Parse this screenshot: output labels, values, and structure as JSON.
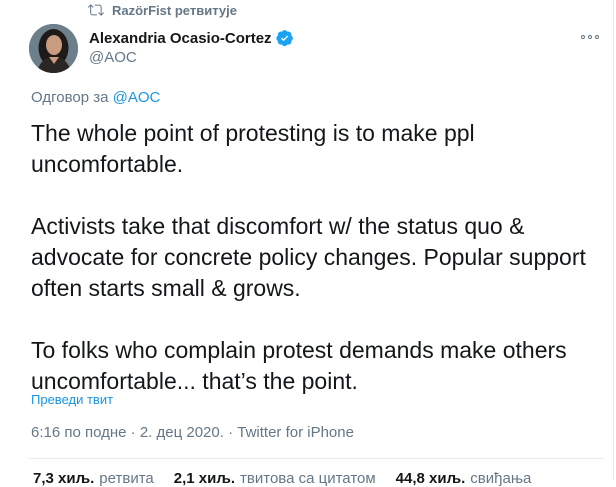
{
  "retweet_header": {
    "icon": "retweet-icon",
    "text": "RazörFist ретвитује"
  },
  "author": {
    "name": "Alexandria Ocasio-Cortez",
    "handle": "@AOC",
    "verified_icon": "verified-badge-icon",
    "verified_color": "#1da1f2"
  },
  "more_icon": "more-options-icon",
  "reply_to": {
    "prefix": "Одговор за",
    "handle": "@AOC"
  },
  "tweet": {
    "paragraph_1": "The whole point of protesting is to make ppl uncomfortable.",
    "paragraph_2": "Activists take that discomfort w/ the status quo & advocate for concrete policy changes. Popular support often starts small & grows.",
    "paragraph_3": "To folks who complain protest demands make others uncomfortable... that’s the point."
  },
  "translate_label": "Преведи твит",
  "meta_line": "6:16 по подне · 2. дец 2020. · Twitter for iPhone",
  "stats": {
    "retweets_count": "7,3 хиљ.",
    "retweets_label": "ретвита",
    "quotes_count": "2,1 хиљ.",
    "quotes_label": "твитова са цитатом",
    "likes_count": "44,8 хиљ.",
    "likes_label": "свиђања"
  },
  "colors": {
    "link_blue": "#1b95e0",
    "secondary_gray": "#657786",
    "text_dark": "#14171a",
    "divider": "#e6ecf0"
  }
}
